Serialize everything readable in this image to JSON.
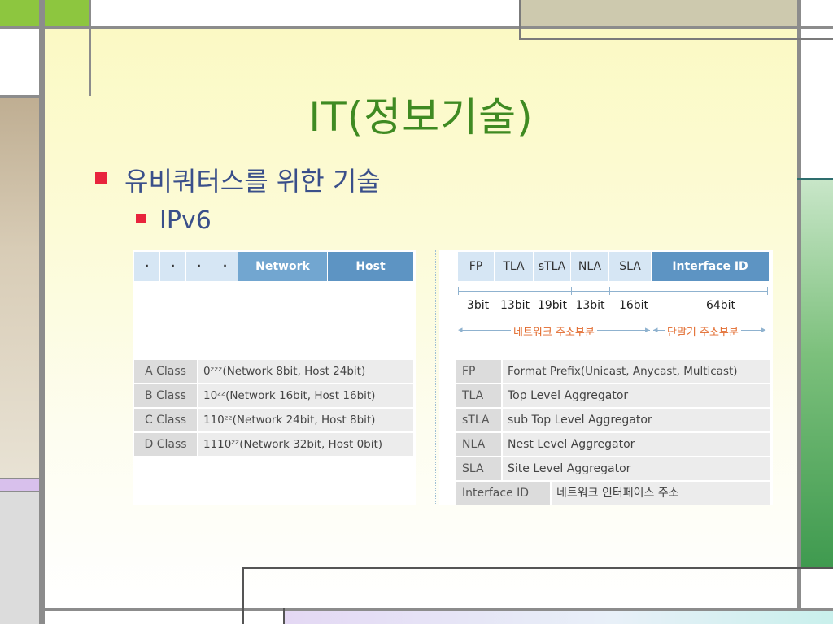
{
  "slide": {
    "title": "IT(정보기술)",
    "bullet1": "유비쿼터스를 위한 기술",
    "bullet2": "IPv6"
  },
  "ipv4": {
    "header_dots": [
      "·",
      "·",
      "·",
      "·"
    ],
    "header_network": "Network",
    "header_host": "Host",
    "classes": [
      {
        "name": "A Class",
        "desc": "0ᶻᶻᶻ(Network 8bit, Host 24bit)"
      },
      {
        "name": "B Class",
        "desc": "10ᶻᶻ(Network 16bit, Host 16bit)"
      },
      {
        "name": "C Class",
        "desc": "110ᶻᶻ(Network 24bit, Host 8bit)"
      },
      {
        "name": "D Class",
        "desc": "1110ᶻᶻ(Network 32bit, Host 0bit)"
      }
    ]
  },
  "ipv6": {
    "fields": [
      "FP",
      "TLA",
      "sTLA",
      "NLA",
      "SLA",
      "Interface ID"
    ],
    "bits": [
      "3bit",
      "13bit",
      "19bit",
      "13bit",
      "16bit",
      "64bit"
    ],
    "network_part": "네트워크 주소부분",
    "terminal_part": "단말기 주소부분",
    "definitions": [
      {
        "abbr": "FP",
        "desc": "Format Prefix(Unicast, Anycast, Multicast)"
      },
      {
        "abbr": "TLA",
        "desc": "Top Level Aggregator"
      },
      {
        "abbr": "sTLA",
        "desc": "sub Top Level Aggregator"
      },
      {
        "abbr": "NLA",
        "desc": "Nest Level Aggregator"
      },
      {
        "abbr": "SLA",
        "desc": "Site Level Aggregator"
      },
      {
        "abbr": "Interface ID",
        "desc": "네트워크 인터페이스 주소"
      }
    ]
  },
  "colors": {
    "title": "#3f8a22",
    "bullet_text": "#3a4f8a",
    "bullet_marker": "#e8243c",
    "header_blue": "#5d94c3",
    "header_light": "#d6e6f4",
    "annotation_orange": "#e26a2c"
  }
}
